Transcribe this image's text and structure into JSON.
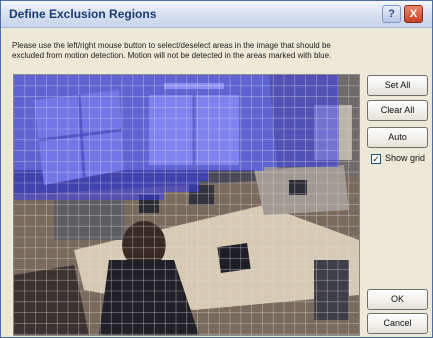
{
  "window": {
    "title": "Define Exclusion Regions",
    "help_label": "?",
    "close_label": "X"
  },
  "instructions": "Please use the left/right mouse button to select/deselect areas in the image that should be excluded from motion detection. Motion will not be detected in the areas marked with blue.",
  "buttons": {
    "set_all": "Set All",
    "clear_all": "Clear All",
    "auto": "Auto",
    "ok": "OK",
    "cancel": "Cancel"
  },
  "show_grid": {
    "label": "Show grid",
    "checked": true,
    "mark": "✓"
  },
  "colors": {
    "exclusion_overlay": "#3a3cf5",
    "grid_line": "#dcdcdc"
  }
}
